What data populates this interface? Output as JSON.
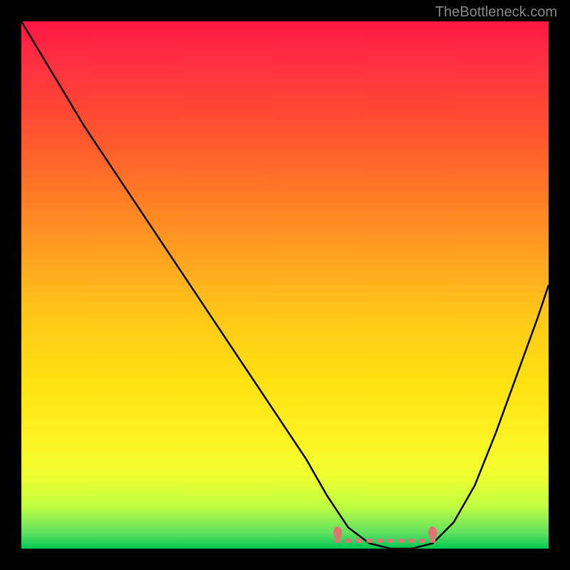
{
  "watermark": "TheBottleneck.com",
  "chart_data": {
    "type": "line",
    "title": "",
    "xlabel": "",
    "ylabel": "",
    "xlim": [
      0,
      100
    ],
    "ylim": [
      0,
      100
    ],
    "grid": false,
    "legend": false,
    "series": [
      {
        "name": "bottleneck-curve",
        "x": [
          0,
          6,
          12,
          18,
          24,
          30,
          36,
          42,
          48,
          54,
          58,
          62,
          66,
          70,
          74,
          78,
          82,
          86,
          90,
          94,
          98,
          100
        ],
        "values": [
          100,
          90,
          80,
          71,
          62,
          53,
          44,
          35,
          26,
          17,
          10,
          4,
          1,
          0,
          0,
          1,
          5,
          12,
          22,
          33,
          44,
          50
        ]
      }
    ],
    "markers": [
      {
        "name": "low-marker",
        "x": 60,
        "y": 3
      },
      {
        "name": "high-marker",
        "x": 78,
        "y": 3
      }
    ],
    "gradient_stops": [
      {
        "pos": 0,
        "color": "#ff1744"
      },
      {
        "pos": 50,
        "color": "#ffd600"
      },
      {
        "pos": 100,
        "color": "#00c853"
      }
    ]
  }
}
